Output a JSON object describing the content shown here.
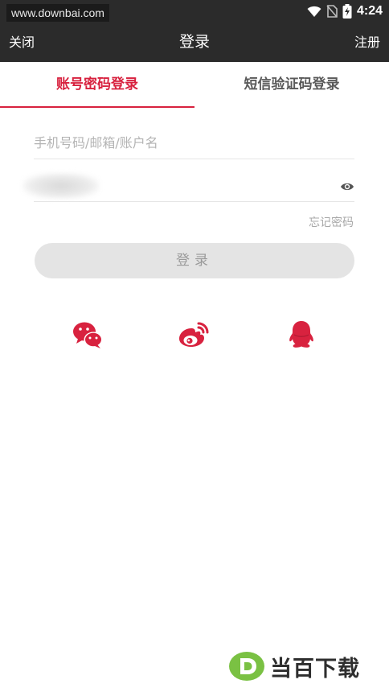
{
  "status_bar": {
    "watermark": "www.downbai.com",
    "time": "4:24"
  },
  "title_bar": {
    "close_label": "关闭",
    "title": "登录",
    "register_label": "注册"
  },
  "tabs": [
    {
      "label": "账号密码登录",
      "active": true
    },
    {
      "label": "短信验证码登录",
      "active": false
    }
  ],
  "form": {
    "account_placeholder": "手机号码/邮箱/账户名",
    "password_value": "",
    "forgot_label": "忘记密码",
    "login_label": "登录"
  },
  "social": {
    "icons": [
      "wechat-icon",
      "weibo-icon",
      "qq-icon"
    ],
    "color": "#d8223f"
  },
  "watermark_bottom": {
    "text": "当百下载"
  },
  "colors": {
    "accent": "#d8223f",
    "header_bg": "#2b2b2b",
    "button_disabled": "#e4e4e4",
    "watermark_green": "#7ac143"
  }
}
